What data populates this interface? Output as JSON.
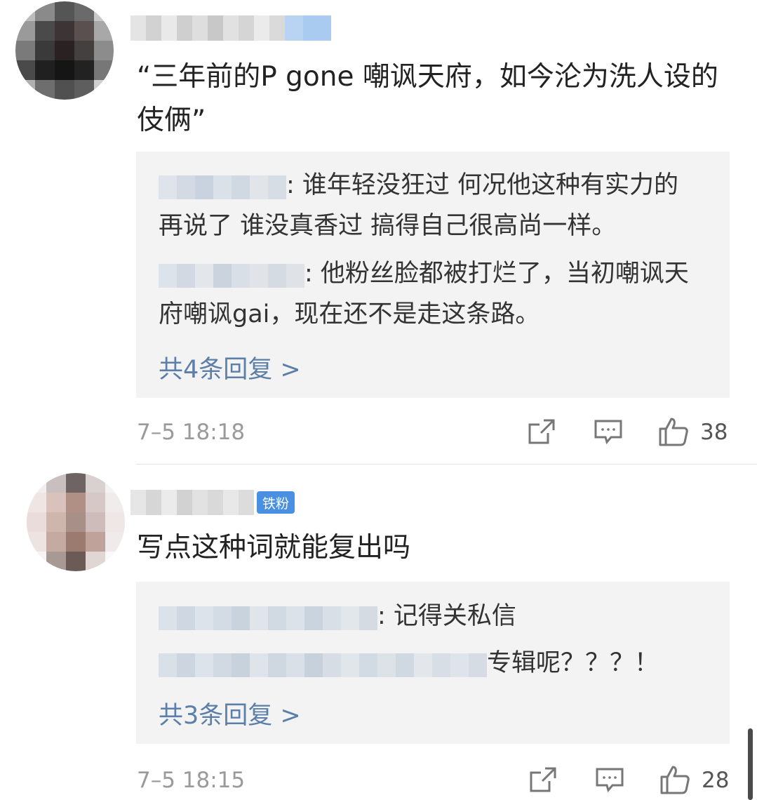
{
  "comments": [
    {
      "text": "“三年前的P gone 嘲讽天府，如今沦为洗人设的伎俩”",
      "replies": [
        {
          "text": ": 谁年轻没狂过 何况他这种有实力的 再说了 谁没真香过 搞得自己很高尚一样。"
        },
        {
          "text": ": 他粉丝脸都被打烂了，当初嘲讽天府嘲讽gai，现在还不是走这条路。"
        }
      ],
      "more_replies": "共4条回复 >",
      "time": "7–5 18:18",
      "like_count": "38"
    },
    {
      "badge": "铁粉",
      "text": "写点这种词就能复出吗",
      "replies": [
        {
          "text": ": 记得关私信"
        },
        {
          "text": "专辑呢？？？！"
        }
      ],
      "more_replies": "共3条回复 >",
      "time": "7–5 18:15",
      "like_count": "28"
    }
  ],
  "icons": {
    "share": "share-icon",
    "comment": "comment-icon",
    "like": "thumbs-up-icon"
  },
  "colors": {
    "link": "#5b7fa8",
    "badge": "#4a90e2",
    "reply_bg": "#f3f3f3"
  }
}
